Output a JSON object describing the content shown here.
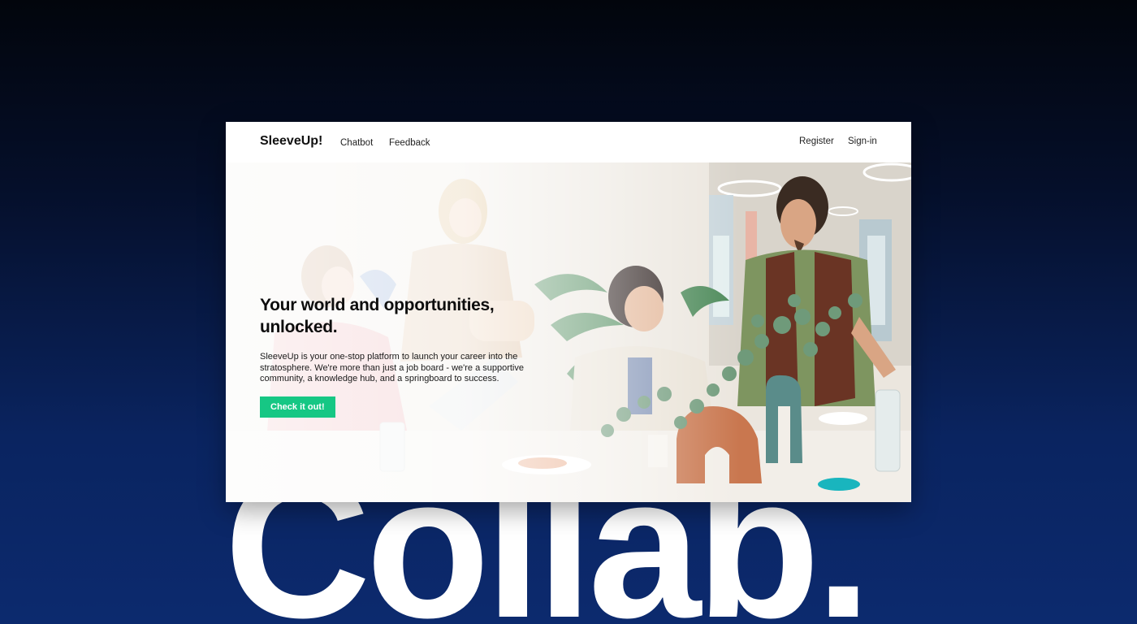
{
  "background": {
    "word": "Collab.",
    "gradient_top": "#02050c",
    "gradient_bottom": "#0c2a6e"
  },
  "navbar": {
    "brand": "SleeveUp!",
    "links": [
      "Chatbot",
      "Feedback"
    ],
    "right_links": [
      "Register",
      "Sign-in"
    ]
  },
  "hero": {
    "image_icon": "office-team-photo",
    "headline_line1": "Your world and opportunities,",
    "headline_line2": "unlocked.",
    "description": "SleeveUp is your one-stop platform to launch your career into the stratosphere. We're more than just a job board - we're a supportive community, a knowledge hub, and a springboard to success.",
    "cta_label": "Check it out!",
    "accent_color": "#16c784"
  }
}
